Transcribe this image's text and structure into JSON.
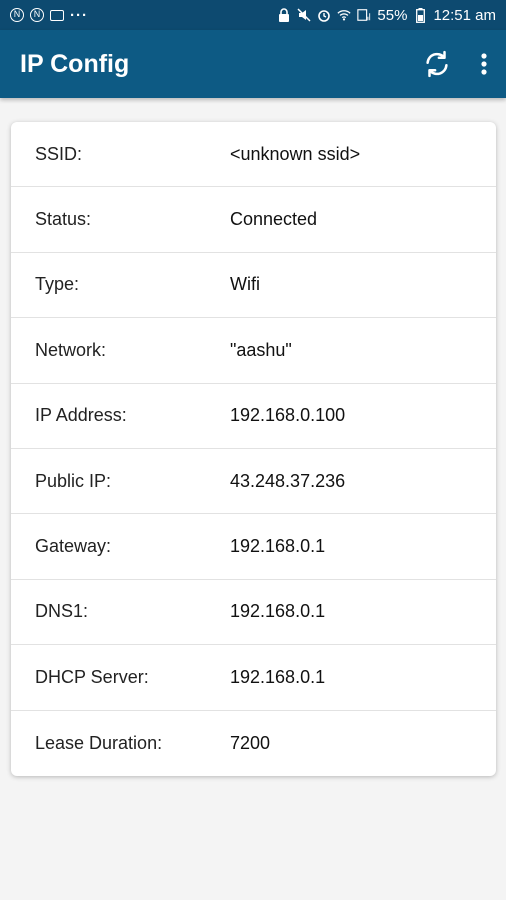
{
  "status_bar": {
    "battery": "55%",
    "time": "12:51 am",
    "left_icons": [
      "circle-n-icon",
      "image-icon",
      "more-dots-icon"
    ],
    "right_icons": [
      "lock-icon",
      "mute-icon",
      "alarm-icon",
      "wifi-icon",
      "signal-icon"
    ]
  },
  "app_bar": {
    "title": "IP Config",
    "refresh_icon": "refresh-icon",
    "more_icon": "more-vert-icon",
    "color": "#0d5a84"
  },
  "info": [
    {
      "label": "SSID:",
      "value": "<unknown ssid>"
    },
    {
      "label": "Status:",
      "value": "Connected"
    },
    {
      "label": "Type:",
      "value": "Wifi"
    },
    {
      "label": "Network:",
      "value": "\"aashu\""
    },
    {
      "label": "IP Address:",
      "value": "192.168.0.100"
    },
    {
      "label": "Public IP:",
      "value": "43.248.37.236"
    },
    {
      "label": "Gateway:",
      "value": "192.168.0.1"
    },
    {
      "label": "DNS1:",
      "value": "192.168.0.1"
    },
    {
      "label": "DHCP Server:",
      "value": "192.168.0.1"
    },
    {
      "label": "Lease Duration:",
      "value": "7200"
    }
  ]
}
